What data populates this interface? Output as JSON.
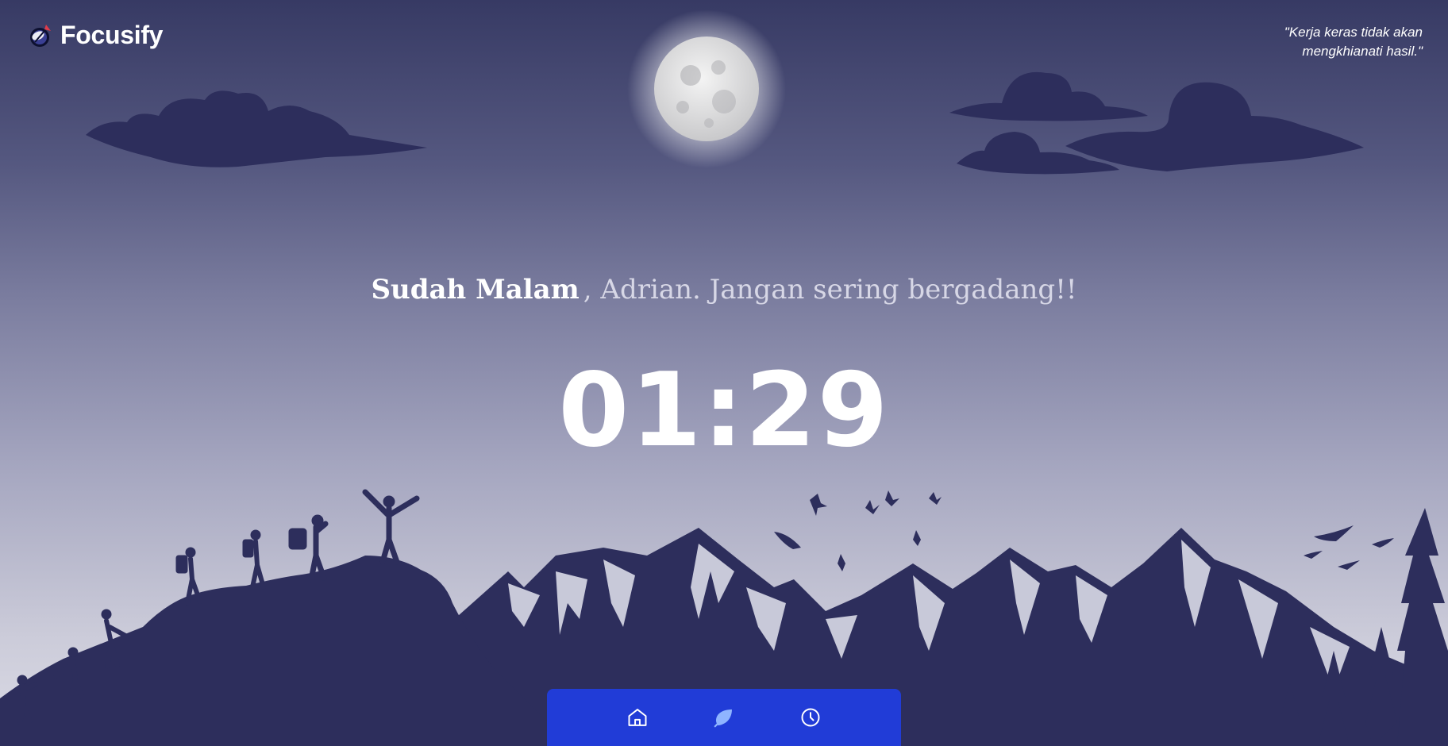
{
  "app": {
    "name": "Focusify"
  },
  "quote": "\"Kerja keras tidak akan mengkhianati hasil.\"",
  "greeting": {
    "main": "Sudah Malam",
    "sub": ", Adrian. Jangan sering bergadang!!"
  },
  "clock": {
    "time": "01:29"
  },
  "nav": [
    {
      "icon": "home-icon"
    },
    {
      "icon": "leaf-icon",
      "active": true
    },
    {
      "icon": "clock-icon"
    }
  ],
  "colors": {
    "accent": "#213ee2",
    "silhouette": "#2d2e5c",
    "sky_top": "#373a64",
    "sky_bottom": "#dcdce6"
  }
}
